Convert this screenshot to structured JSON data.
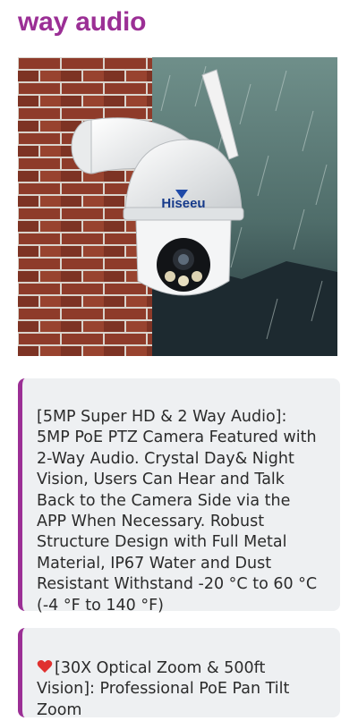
{
  "page": {
    "heading": "way audio",
    "accent_color": "#9b2f95"
  },
  "product_image": {
    "brand_logo_text": "Hiseeu",
    "icon": "ptz-security-camera-photo"
  },
  "features": [
    {
      "text": "[5MP Super HD & 2 Way Audio]: 5MP PoE PTZ Camera Featured with 2-Way Audio. Crystal Day& Night Vision, Users Can Hear and Talk Back to the Camera Side via the APP When Necessary. Robust Structure Design with Full Metal Material, IP67 Water and Dust Resistant Withstand -20 °C to 60 °C (-4 °F to 140 °F)"
    },
    {
      "emoji": "heart-icon",
      "text": "[30X Optical Zoom & 500ft Vision]: Professional PoE Pan Tilt Zoom"
    }
  ]
}
